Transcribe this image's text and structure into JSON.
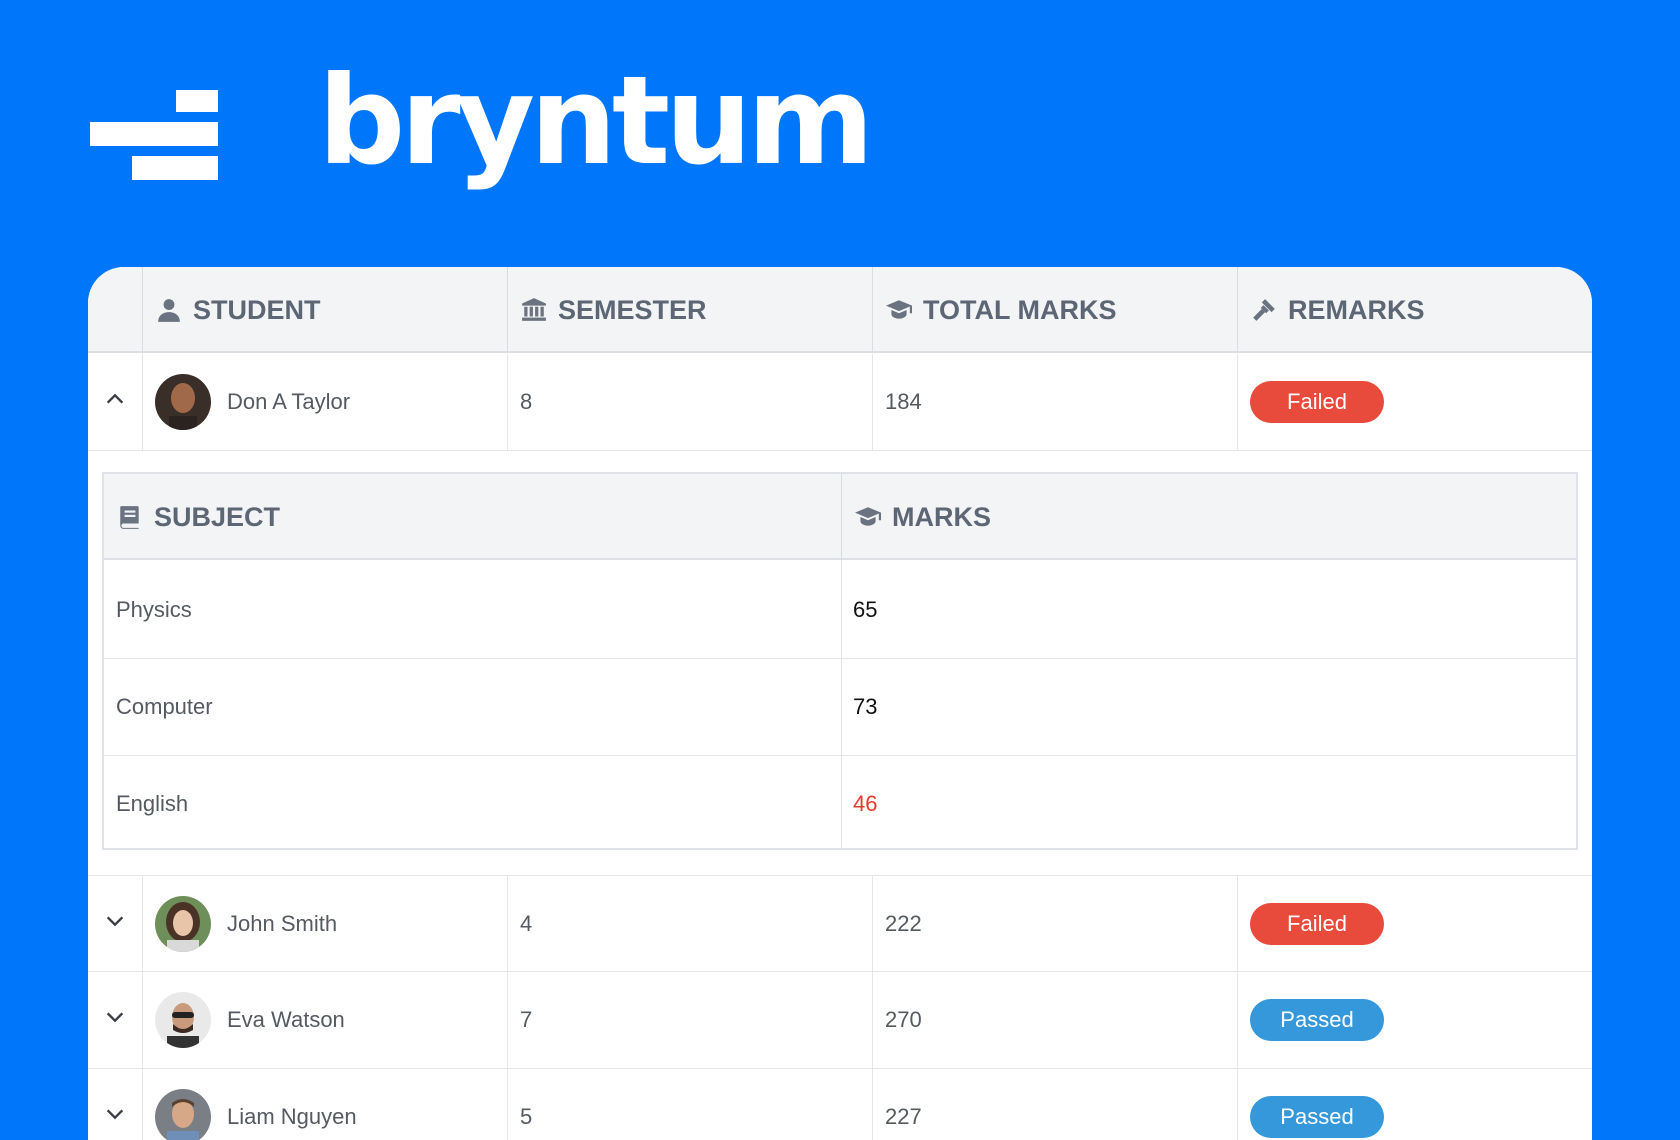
{
  "brand": {
    "name": "bryntum",
    "color": "#0076fa"
  },
  "grid": {
    "columns": [
      {
        "label": "STUDENT",
        "icon": "user-icon"
      },
      {
        "label": "SEMESTER",
        "icon": "institution-icon"
      },
      {
        "label": "TOTAL MARKS",
        "icon": "graduation-cap-icon"
      },
      {
        "label": "REMARKS",
        "icon": "gavel-icon"
      }
    ],
    "rows": [
      {
        "name": "Don A Taylor",
        "semester": "8",
        "total": "184",
        "remark": "Failed",
        "expanded": true
      },
      {
        "name": "John Smith",
        "semester": "4",
        "total": "222",
        "remark": "Failed",
        "expanded": false
      },
      {
        "name": "Eva Watson",
        "semester": "7",
        "total": "270",
        "remark": "Passed",
        "expanded": false
      },
      {
        "name": "Liam Nguyen",
        "semester": "5",
        "total": "227",
        "remark": "Passed",
        "expanded": false
      }
    ],
    "remark_colors": {
      "Failed": "#e84a3b",
      "Passed": "#3498db"
    }
  },
  "subgrid": {
    "columns": [
      {
        "label": "SUBJECT",
        "icon": "book-icon"
      },
      {
        "label": "MARKS",
        "icon": "graduation-cap-icon"
      }
    ],
    "rows": [
      {
        "subject": "Physics",
        "marks": "65",
        "low": false
      },
      {
        "subject": "Computer",
        "marks": "73",
        "low": false
      },
      {
        "subject": "English",
        "marks": "46",
        "low": true
      }
    ],
    "low_mark_color": "#e53b2c"
  }
}
